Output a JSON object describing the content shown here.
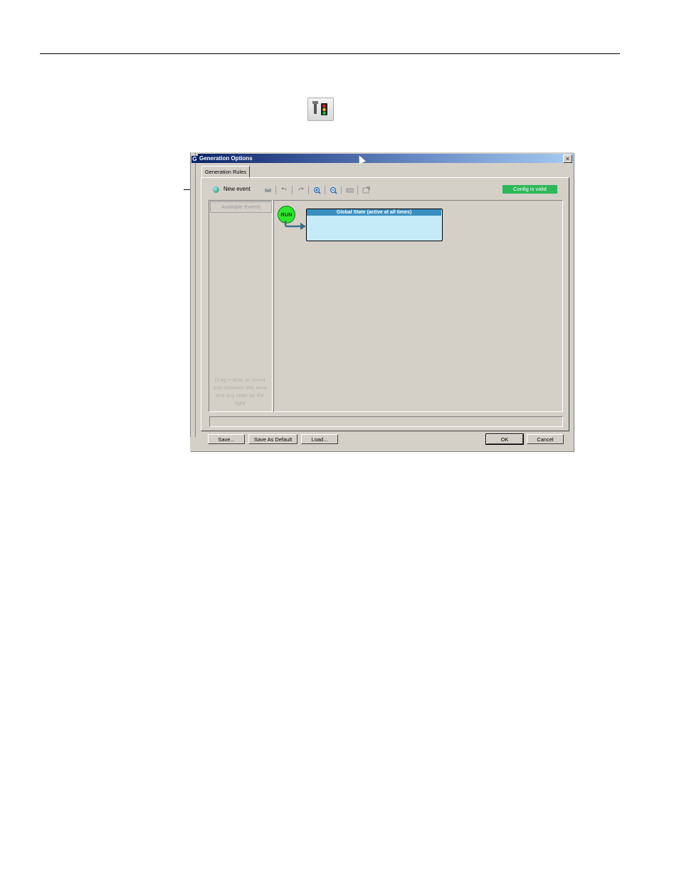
{
  "dialog": {
    "title": "Generation Options",
    "back_icon_letter": "G",
    "close_glyph": "×",
    "tab_label": "Generation Rules",
    "toolbar": {
      "new_event_label": "New event",
      "icons": [
        "print-icon",
        "undo-icon",
        "redo-icon",
        "zoom-in-icon",
        "zoom-out-icon",
        "keyboard-icon",
        "export-icon"
      ],
      "status_badge": "Config is valid",
      "status_color": "#2db85a"
    },
    "left_panel": {
      "header": "Available Events",
      "hint": "Drag-n-drop an event icon between this area and any state on the right"
    },
    "canvas": {
      "run_label": "RUN",
      "state_title": "Global State (active at all times)"
    },
    "buttons": {
      "save": "Save...",
      "save_default": "Save As Default",
      "load": "Load...",
      "ok": "OK",
      "cancel": "Cancel"
    }
  }
}
